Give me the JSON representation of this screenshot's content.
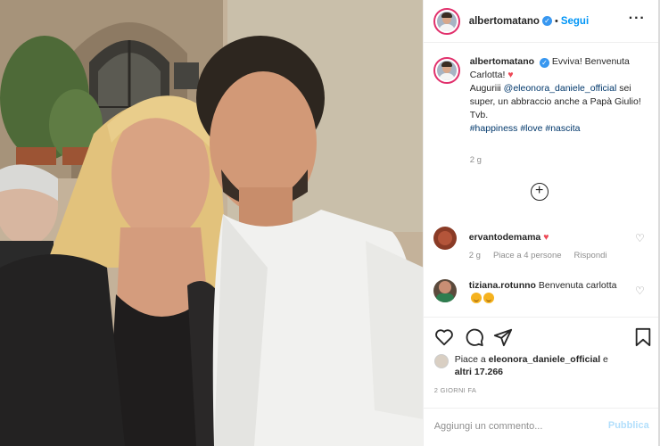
{
  "post": {
    "header": {
      "username": "albertomatano",
      "separator": "•",
      "follow_label": "Segui",
      "more_icon": "···"
    },
    "caption": {
      "username": "albertomatano",
      "line1": "Evviva! Benvenuta Carlotta!",
      "heart": "♥",
      "line2_prefix": "Auguriii ",
      "mention": "@eleonora_daniele_official",
      "line2_suffix": " sei super, un abbraccio anche a Papà Giulio! Tvb.",
      "tags": "#happiness #love #nascita",
      "time": "2 g"
    },
    "load_more_icon": "+",
    "comments": [
      {
        "username": "ervantodemama",
        "text": "",
        "heart": "♥",
        "time": "2 g",
        "likes": "Piace a 4 persone",
        "reply": "Rispondi"
      },
      {
        "username": "tiziana.rotunno",
        "text": "Benvenuta carlotta"
      }
    ],
    "likes": {
      "prefix": "Piace a ",
      "user": "eleonora_daniele_official",
      "middle": " e",
      "others": "altri 17.266"
    },
    "time_ago": "2 GIORNI FA",
    "add_comment": {
      "placeholder": "Aggiungi un commento...",
      "publish_label": "Pubblica"
    }
  },
  "colors": {
    "link_blue": "#0095f6",
    "mention_blue": "#00376b",
    "heart_red": "#ed4956",
    "muted": "#8e8e8e",
    "publish_disabled": "#b2dffc"
  },
  "icons": [
    "heart-outline-icon",
    "comment-icon",
    "share-icon",
    "bookmark-icon",
    "verified-icon",
    "plus-circle-icon",
    "more-icon"
  ]
}
